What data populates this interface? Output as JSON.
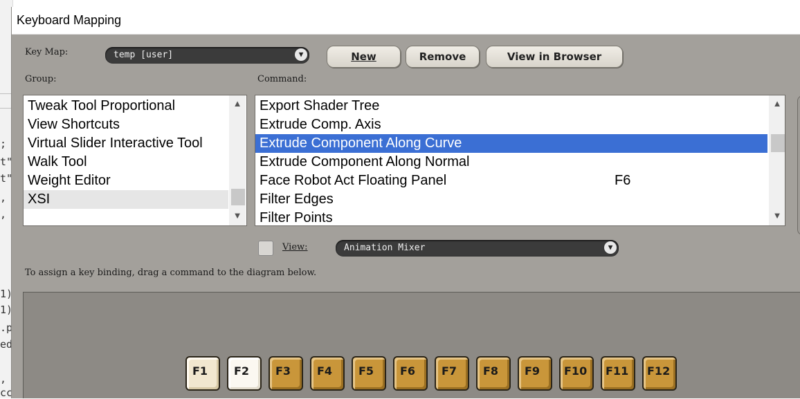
{
  "background_editor": {
    "lines": [
      ";",
      "t\"",
      "t\"",
      ",",
      ",",
      "1)",
      "1)",
      ".p",
      "ed",
      ",",
      "cc"
    ]
  },
  "window": {
    "title": "Keyboard Mapping"
  },
  "keymap": {
    "label": "Key Map:",
    "value": "temp [user]",
    "buttons": {
      "new": "New",
      "remove": "Remove",
      "view_in_browser": "View in Browser"
    }
  },
  "group": {
    "label": "Group:",
    "items": [
      "Tweak Tool Proportional",
      "View Shortcuts",
      "Virtual Slider Interactive Tool",
      "Walk Tool",
      "Weight Editor",
      "XSI"
    ],
    "highlighted": "XSI"
  },
  "command": {
    "label": "Command:",
    "items": [
      {
        "name": "Export Shader Tree",
        "key": ""
      },
      {
        "name": "Extrude Comp. Axis",
        "key": ""
      },
      {
        "name": "Extrude Component Along Curve",
        "key": ""
      },
      {
        "name": "Extrude Component Along Normal",
        "key": ""
      },
      {
        "name": "Face Robot Act Floating Panel",
        "key": "F6"
      },
      {
        "name": "Filter Edges",
        "key": ""
      },
      {
        "name": "Filter Points",
        "key": ""
      }
    ],
    "selected": "Extrude Component Along Curve"
  },
  "view": {
    "label": "View:",
    "checked": false,
    "value": "Animation Mixer"
  },
  "instruction": "To assign a key binding, drag a command to the diagram below.",
  "keys": [
    "F1",
    "F2",
    "F3",
    "F4",
    "F5",
    "F6",
    "F7",
    "F8",
    "F9",
    "F10",
    "F11",
    "F12"
  ],
  "colors": {
    "selection": "#3b6fd4",
    "panel": "#a3a09b",
    "key_assigned": "#c9963a",
    "key_unassigned": "#f1e7cf"
  }
}
